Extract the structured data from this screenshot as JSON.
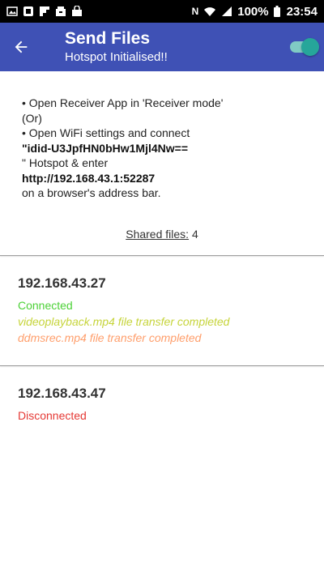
{
  "status_bar": {
    "battery": "100%",
    "time": "23:54"
  },
  "app_bar": {
    "title": "Send Files",
    "subtitle": "Hotspot Initialised!!",
    "hotspot_toggle_on": true
  },
  "instructions": {
    "lines": [
      "• Open Receiver App in 'Receiver mode'",
      "(Or)",
      "• Open WiFi settings and connect",
      "\"idid-U3JpfHN0bHw1Mjl4Nw==",
      "\" Hotspot & enter",
      "http://192.168.43.1:52287",
      "on a browser's address bar."
    ]
  },
  "shared_files": {
    "label": "Shared files:",
    "count": "4"
  },
  "clients": [
    {
      "ip": "192.168.43.27",
      "status": "Connected",
      "logs": [
        "videoplayback.mp4 file transfer completed",
        "ddmsrec.mp4 file transfer completed"
      ]
    },
    {
      "ip": "192.168.43.47",
      "status": "Disconnected",
      "logs": []
    }
  ],
  "colors": {
    "app_bar": "#3f51b5",
    "connected": "#4cd137",
    "log_1": "#c6d43a",
    "log_2": "#ff9e6b",
    "disconnected": "#e53935",
    "toggle": "#26a69a"
  },
  "icons": {
    "back": "arrow-left-icon",
    "status_left": [
      "image-icon",
      "gallery-icon",
      "flipboard-icon",
      "box-icon",
      "shopping-bag-icon"
    ],
    "status_right": [
      "nfc-icon",
      "wifi-icon",
      "signal-icon",
      "battery-icon"
    ]
  }
}
